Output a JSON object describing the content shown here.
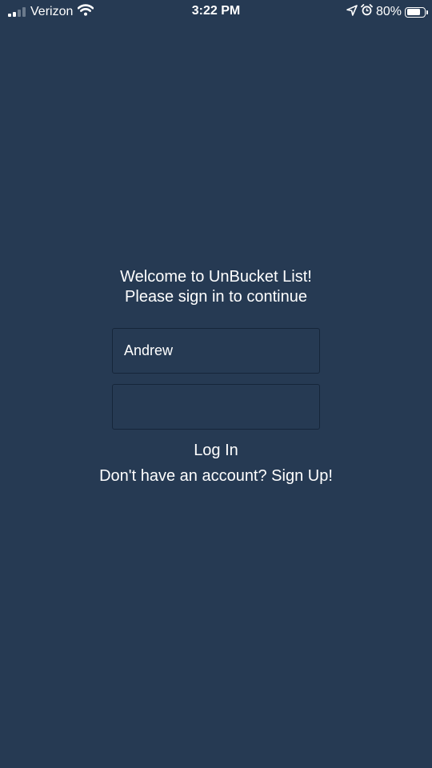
{
  "status_bar": {
    "carrier": "Verizon",
    "time": "3:22 PM",
    "battery_percent": "80%",
    "battery_level": 0.8,
    "signal_bars_filled": 2,
    "signal_bars_total": 4,
    "icons": [
      "signal-bars-icon",
      "wifi-icon",
      "location-arrow-icon",
      "alarm-icon",
      "battery-icon"
    ]
  },
  "login": {
    "welcome_line1": "Welcome to UnBucket List!",
    "welcome_line2": "Please sign in to continue",
    "username_value": "Andrew",
    "password_value": "",
    "login_label": "Log In",
    "signup_label": "Don't have an account? Sign Up!"
  },
  "colors": {
    "background": "#263a53",
    "field_border": "#16263a",
    "text": "#ffffff"
  }
}
